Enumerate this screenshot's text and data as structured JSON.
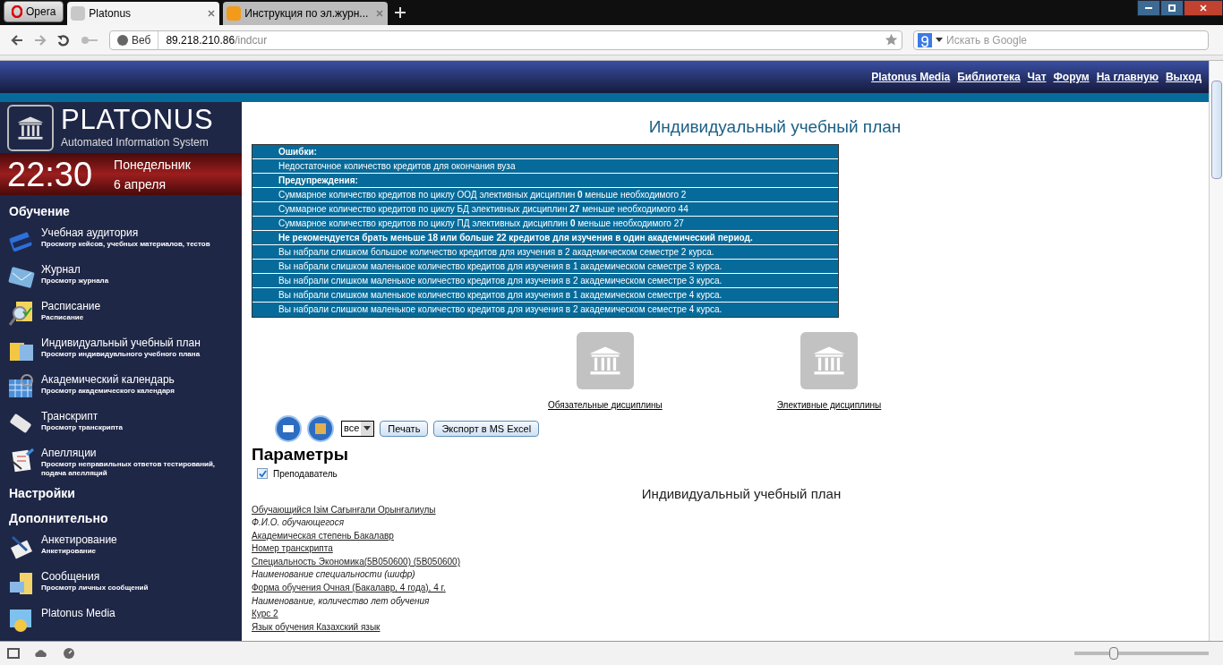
{
  "browser": {
    "menu_button": "Opera",
    "tabs": [
      {
        "label": "Platonus",
        "selected": true
      },
      {
        "label": "Инструкция по эл.журн...",
        "selected": false
      }
    ],
    "address": {
      "badge": "Веб",
      "host": "89.218.210.86",
      "path": "/indcur"
    },
    "search": {
      "placeholder": "Искать в Google"
    },
    "zoom": {
      "level": 0.28
    }
  },
  "top_links": [
    "Platonus Media",
    "Библиотека",
    "Чат",
    "Форум",
    "На главную",
    "Выход"
  ],
  "logo": {
    "title": "PLATONUS",
    "subtitle": "Automated Information System"
  },
  "clock": {
    "time": "22:30",
    "weekday": "Понедельник",
    "date": "6 апреля"
  },
  "sidebar": [
    {
      "kind": "heading",
      "title": "Обучение"
    },
    {
      "kind": "item",
      "title": "Учебная аудитория",
      "subtitle": "Просмотр кейсов, учебных материалов, тестов"
    },
    {
      "kind": "item",
      "title": "Журнал",
      "subtitle": "Просмотр журнала"
    },
    {
      "kind": "item",
      "title": "Расписание",
      "subtitle": "Расписание"
    },
    {
      "kind": "item",
      "title": "Индивидуальный учебный план",
      "subtitle": "Просмотр индивидуального учебного плана"
    },
    {
      "kind": "item",
      "title": "Академический календарь",
      "subtitle": "Просмотр академического календаря"
    },
    {
      "kind": "item",
      "title": "Транскрипт",
      "subtitle": "Просмотр транскрипта"
    },
    {
      "kind": "item",
      "title": "Апелляции",
      "subtitle": "Просмотр неправильных ответов тестирований, подача апелляций"
    },
    {
      "kind": "heading",
      "title": "Настройки"
    },
    {
      "kind": "heading",
      "title": "Дополнительно"
    },
    {
      "kind": "item",
      "title": "Анкетирование",
      "subtitle": "Анкетирование"
    },
    {
      "kind": "item",
      "title": "Сообщения",
      "subtitle": "Просмотр личных сообщений"
    },
    {
      "kind": "item",
      "title": "Platonus Media"
    }
  ],
  "page_title": "Индивидуальный учебный план",
  "messages": [
    {
      "kind": "header",
      "text": "Ошибки:"
    },
    {
      "kind": "text",
      "text": "Недостаточное количество кредитов для окончания вуза"
    },
    {
      "kind": "header",
      "text": "Предупреждения:"
    },
    {
      "kind": "text",
      "text": "Суммарное количество кредитов по циклу ООД элективных дисциплин **0** меньше необходимого 2"
    },
    {
      "kind": "text",
      "text": "Суммарное количество кредитов по циклу БД элективных дисциплин **27** меньше необходимого 44"
    },
    {
      "kind": "text",
      "text": "Суммарное количество кредитов по циклу ПД элективных дисциплин **0** меньше необходимого 27"
    },
    {
      "kind": "header",
      "text": "Не рекомендуется брать меньше 18 или больше 22 кредитов для изучения в один академический период."
    },
    {
      "kind": "text",
      "text": "Вы набрали слишком большое количество кредитов для изучения в 2 академическом семестре 2 курса."
    },
    {
      "kind": "text",
      "text": "Вы набрали слишком маленькое количество кредитов для изучения в 1 академическом семестре 3 курса."
    },
    {
      "kind": "text",
      "text": "Вы набрали слишком маленькое количество кредитов для изучения в 2 академическом семестре 3 курса."
    },
    {
      "kind": "text",
      "text": "Вы набрали слишком маленькое количество кредитов для изучения в 1 академическом семестре 4 курса."
    },
    {
      "kind": "text",
      "text": "Вы набрали слишком маленькое количество кредитов для изучения в 2 академическом семестре 4 курса."
    }
  ],
  "disciplines": [
    "Обязательные дисциплины",
    "Элективные дисциплины"
  ],
  "toolbar": {
    "select_value": "все",
    "buttons": [
      "Печать",
      "Экспорт в MS Excel"
    ]
  },
  "parameters": {
    "title": "Параметры",
    "options": [
      {
        "label": "Преподаватель",
        "checked": true
      }
    ]
  },
  "plan_title": "Индивидуальный учебный план",
  "fields": [
    {
      "kind": "link",
      "text": "Обучающийся Ізім Сағынғали Орынғалиулы"
    },
    {
      "kind": "caption",
      "text": "Ф.И.О. обучающегося"
    },
    {
      "kind": "link",
      "text": "Академическая степень Бакалавр"
    },
    {
      "kind": "link",
      "text": "Номер транскрипта"
    },
    {
      "kind": "link",
      "text": "Специальность Экономика(5B050600) (5B050600)"
    },
    {
      "kind": "caption",
      "text": "Наименование специальности (шифр)"
    },
    {
      "kind": "link",
      "text": "Форма обучения Очная (Бакалавр, 4 года), 4 г."
    },
    {
      "kind": "caption",
      "text": "Наименование, количество лет обучения"
    },
    {
      "kind": "link",
      "text": "Курс 2"
    },
    {
      "kind": "link",
      "text": "Язык обучения Казахский язык"
    }
  ]
}
